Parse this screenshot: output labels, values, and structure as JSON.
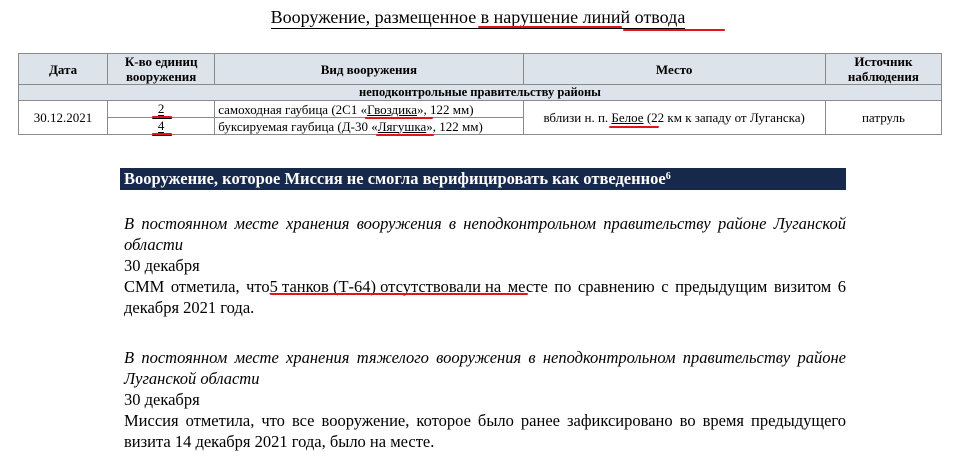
{
  "title": "Вооружение, размещенное в нарушение линий отвода",
  "table": {
    "headers": {
      "date": "Дата",
      "qty": "К-во единиц вооружения",
      "type": "Вид вооружения",
      "place": "Место",
      "source": "Источник наблюдения"
    },
    "section_label": "неподконтрольные правительству районы",
    "row": {
      "date": "30.12.2021",
      "place_prefix": "вблизи н. п. ",
      "place_name": "Белое",
      "place_suffix": " (22 км к западу от Луганска)",
      "source": "патруль",
      "items": [
        {
          "qty": "2",
          "type_prefix": "самоходная гаубица (2С1 «",
          "type_name": "Гвоздика",
          "type_suffix": "», 122 мм)"
        },
        {
          "qty": "4",
          "type_prefix": "буксируемая гаубица (Д-30 «",
          "type_name": "Лягушка",
          "type_suffix": "», 122 мм)"
        }
      ]
    }
  },
  "section2": {
    "heading": "Вооружение, которое Миссия не смогла верифицировать как отведенное",
    "footnote": "6",
    "blocks": [
      {
        "location": "В постоянном месте хранения вооружения в неподконтрольном правительству районе Луганской области",
        "date": "30 декабря",
        "text_prefix": "СММ отметила, что",
        "text_highlight": " 5 танков (Т-64) отсутствовали н",
        "text_suffix": "а месте по сравнению с предыдущим визитом 6 декабря 2021 года."
      },
      {
        "location": "В постоянном месте хранения тяжелого вооружения в неподконтрольном правительству районе Луганской области",
        "date": "30 декабря",
        "text": "Миссия отметила, что все вооружение, которое было ранее зафиксировано во время предыдущего визита 14 декабря 2021 года, было на месте."
      }
    ]
  },
  "colors": {
    "header_bg": "#dde3ea",
    "heading_bar_bg": "#17294a",
    "annotation_red": "#e0141e"
  }
}
